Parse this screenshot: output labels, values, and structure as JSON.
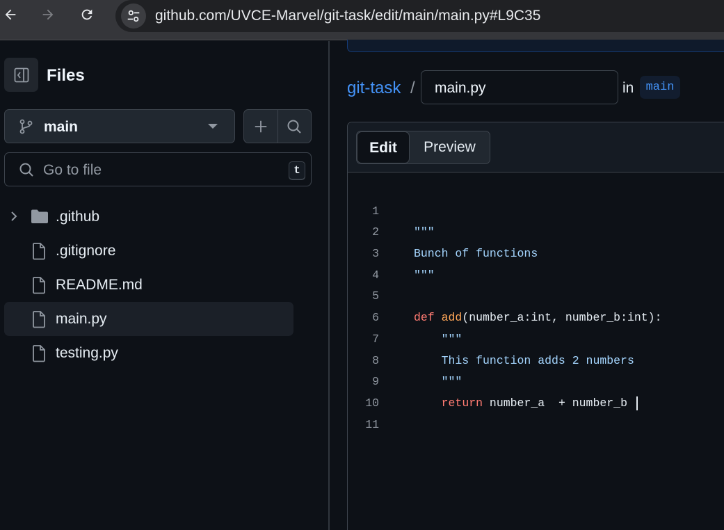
{
  "browser": {
    "url": "github.com/UVCE-Marvel/git-task/edit/main/main.py#L9C35"
  },
  "sidebar": {
    "title": "Files",
    "branch": "main",
    "search_placeholder": "Go to file",
    "search_shortcut": "t",
    "items": [
      {
        "label": ".github",
        "type": "folder",
        "icon": "folder-icon"
      },
      {
        "label": ".gitignore",
        "type": "file",
        "icon": "file-icon"
      },
      {
        "label": "README.md",
        "type": "file",
        "icon": "file-icon"
      },
      {
        "label": "main.py",
        "type": "file",
        "icon": "file-icon",
        "selected": true
      },
      {
        "label": "testing.py",
        "type": "file",
        "icon": "file-icon"
      }
    ]
  },
  "main": {
    "repo": "git-task",
    "separator": "/",
    "filename": "main.py",
    "in_label": "in",
    "branch": "main",
    "tabs": {
      "edit": "Edit",
      "preview": "Preview",
      "active": "Edit"
    },
    "code_lines": [
      {
        "n": "1",
        "text": "\"\"\""
      },
      {
        "n": "2",
        "text": "Bunch of functions"
      },
      {
        "n": "3",
        "text": "\"\"\""
      },
      {
        "n": "4",
        "text": ""
      },
      {
        "n": "5",
        "text": "def add(number_a:int, number_b:int):"
      },
      {
        "n": "6",
        "text": "    \"\"\""
      },
      {
        "n": "7",
        "text": "    This function adds 2 numbers"
      },
      {
        "n": "8",
        "text": "    \"\"\""
      },
      {
        "n": "9",
        "text": "    return number_a  + number_b "
      },
      {
        "n": "10",
        "text": ""
      },
      {
        "n": "11",
        "text": ""
      }
    ]
  },
  "colors": {
    "link": "#4493f8",
    "keyword": "#ff7b72",
    "function": "#ffa657",
    "string": "#a5d6ff"
  }
}
